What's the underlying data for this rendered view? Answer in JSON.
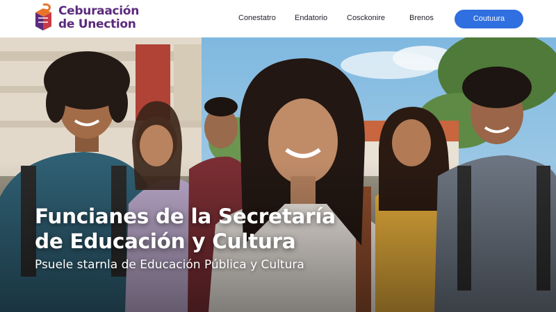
{
  "brand": {
    "line1": "Ceburaación",
    "line2": "de Unection",
    "logo_icon": "cube-ribbon-logo",
    "colors": {
      "orange": "#e8742a",
      "purple": "#5b2a7e",
      "red": "#c83a45"
    }
  },
  "nav": {
    "items": [
      "Conestatro",
      "Endatorio",
      "Cosckonire",
      "Brenos"
    ],
    "cta_label": "Coutuura",
    "cta_color": "#2f6fe0"
  },
  "hero": {
    "title_line1": "Funcianes de la Secretaría",
    "title_line2": "de Educación y Cultura",
    "subtitle": "Psuele starnla de Educación Pública y Cultura",
    "image": "group-of-smiling-students-outdoors"
  }
}
